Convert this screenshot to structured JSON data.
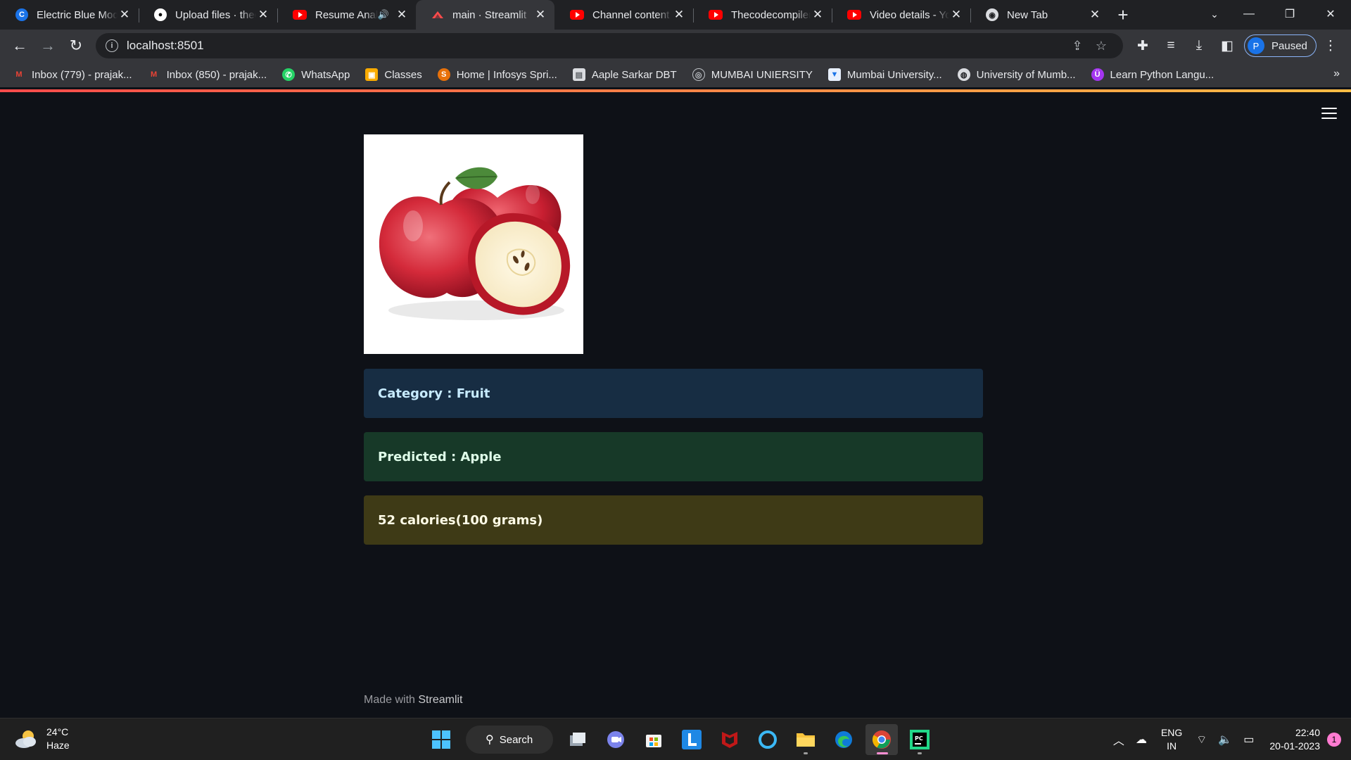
{
  "browser": {
    "tabs": [
      {
        "title": "Electric Blue Mod",
        "icon": "c-logo-icon",
        "color": "#1a73e8"
      },
      {
        "title": "Upload files · thec",
        "icon": "github-icon",
        "color": "#ffffff"
      },
      {
        "title": "Resume Analy",
        "icon": "youtube-icon",
        "color": "#ff0000",
        "audio": true
      },
      {
        "title": "main · Streamlit",
        "icon": "streamlit-icon",
        "color": "#ff4b4b",
        "active": true
      },
      {
        "title": "Channel content",
        "icon": "youtube-icon",
        "color": "#ff0000"
      },
      {
        "title": "Thecodecompiler",
        "icon": "youtube-icon",
        "color": "#ff0000"
      },
      {
        "title": "Video details - Yo",
        "icon": "youtube-icon",
        "color": "#ff0000"
      },
      {
        "title": "New Tab",
        "icon": "chrome-icon",
        "color": "#ffffff"
      }
    ],
    "url": "localhost:8501",
    "profile_status": "Paused",
    "profile_initial": "P",
    "bookmarks": [
      {
        "label": "Inbox (779) - prajak...",
        "icon": "gmail-icon"
      },
      {
        "label": "Inbox (850) - prajak...",
        "icon": "gmail-icon"
      },
      {
        "label": "WhatsApp",
        "icon": "whatsapp-icon"
      },
      {
        "label": "Classes",
        "icon": "classroom-icon"
      },
      {
        "label": "Home | Infosys Spri...",
        "icon": "infosys-icon"
      },
      {
        "label": "Aaple Sarkar DBT",
        "icon": "document-icon"
      },
      {
        "label": "MUMBAI UNIERSITY",
        "icon": "university-seal-icon"
      },
      {
        "label": "Mumbai University...",
        "icon": "university-icon"
      },
      {
        "label": "University of Mumb...",
        "icon": "globe-icon"
      },
      {
        "label": "Learn Python Langu...",
        "icon": "udemy-icon"
      }
    ],
    "bookmarks_more": "»"
  },
  "app": {
    "image_alt": "apple-image",
    "category_text": "Category : Fruit",
    "predicted_text": "Predicted : Apple",
    "calories_text": "52 calories(100 grams)",
    "footer_prefix": "Made with ",
    "footer_brand": "Streamlit",
    "colors": {
      "info_bg": "#172d43",
      "success_bg": "#173928",
      "warning_bg": "#3e3a16",
      "page_bg": "#0e1117"
    }
  },
  "taskbar": {
    "temperature": "24°C",
    "weather": "Haze",
    "search_label": "Search",
    "lang_line1": "ENG",
    "lang_line2": "IN",
    "time": "22:40",
    "date": "20-01-2023",
    "notifications": "1"
  }
}
